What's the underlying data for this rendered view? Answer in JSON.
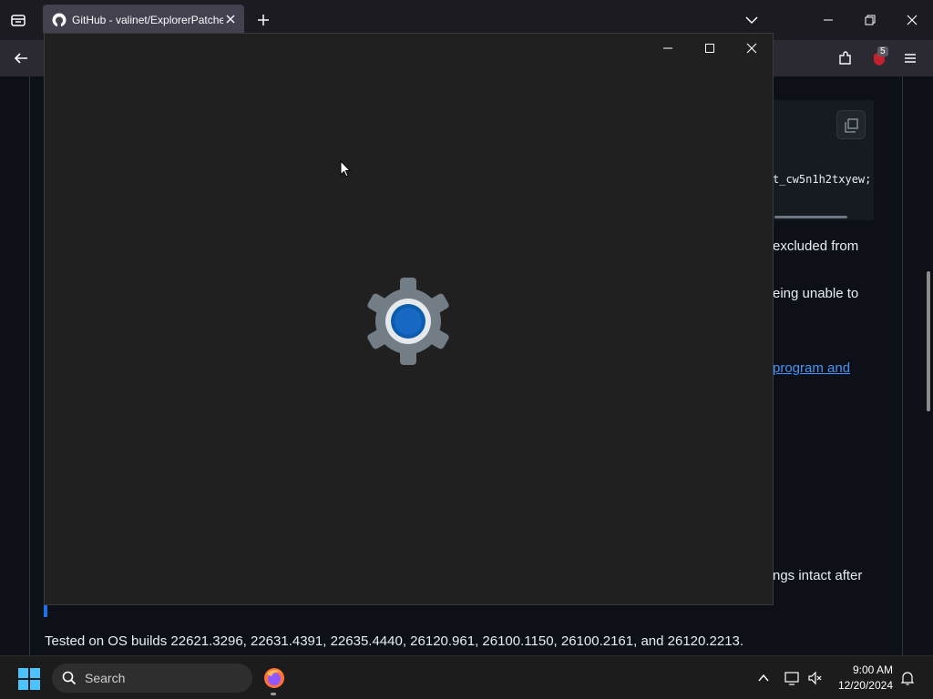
{
  "browser": {
    "tab_title": "GitHub - valinet/ExplorerPatcher",
    "extension_badge": "5"
  },
  "page": {
    "code_snippet": "t_cw5n1h2txyew;",
    "line_1": "excluded from",
    "line_2": "eing unable to",
    "link_text": "program and",
    "line_3": "ngs intact after",
    "tested_line": "Tested on OS builds 22621.3296, 22631.4391, 22635.4440, 26120.961, 26100.1150, 26100.2161, and 26120.2213."
  },
  "settings_window": {
    "icon": "settings-gear-icon",
    "accent": "#0b5cad"
  },
  "taskbar": {
    "search_placeholder": "Search",
    "time": "9:00 AM",
    "date": "12/20/2024"
  },
  "colors": {
    "accent": "#0078d4",
    "link": "#4493f8",
    "badge": "#c6202e"
  }
}
